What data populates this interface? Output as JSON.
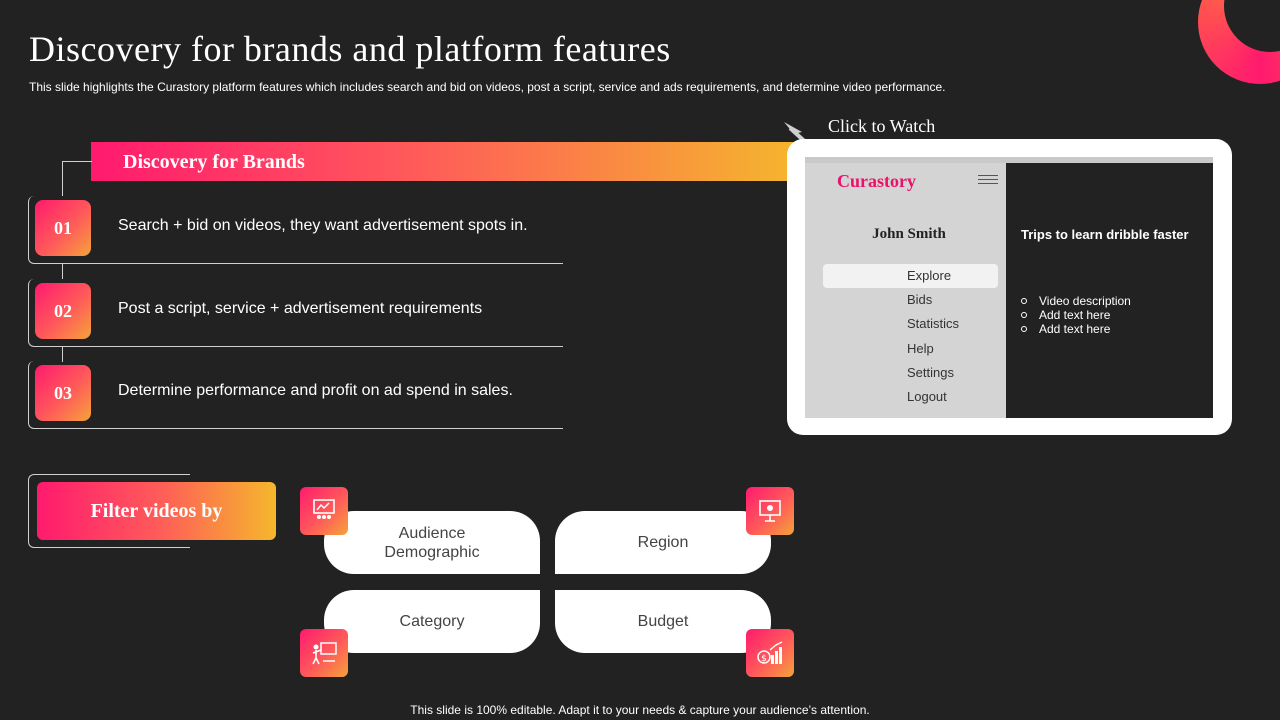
{
  "slide": {
    "title": "Discovery  for brands and platform  features",
    "subtitle": "This slide highlights the Curastory platform features which includes search and bid on videos, post a script, service and ads requirements, and determine video performance.",
    "footer": "This slide is 100% editable. Adapt it to your needs & capture your audience’s attention."
  },
  "discovery": {
    "banner": "Discovery  for Brands",
    "steps": [
      {
        "num": "01",
        "text": "Search + bid on videos, they want advertisement spots in."
      },
      {
        "num": "02",
        "text": "Post a script, service + advertisement requirements"
      },
      {
        "num": "03",
        "text": "Determine performance and profit on ad spend in sales."
      }
    ]
  },
  "filter": {
    "label": "Filter videos by",
    "chips": [
      "Audience Demographic",
      "Region",
      "Category",
      "Budget"
    ]
  },
  "mockup": {
    "click_label": "Click to Watch",
    "brand": "Curastory",
    "user": "John Smith",
    "nav": [
      "Explore",
      "Bids",
      "Statistics",
      "Help",
      "Settings",
      "Logout"
    ],
    "active_nav": "Explore",
    "video_title": "Trips to learn dribble faster",
    "video_items": [
      "Video description",
      "Add text here",
      "Add text here"
    ]
  },
  "colors": {
    "background": "#232223",
    "accent_pink": "#ff1a6e",
    "accent_orange": "#f5b72c",
    "brand_text": "#e8126a"
  },
  "icons": [
    "audience-icon",
    "region-icon",
    "category-icon",
    "budget-icon",
    "cursor-icon",
    "menu-icon"
  ]
}
